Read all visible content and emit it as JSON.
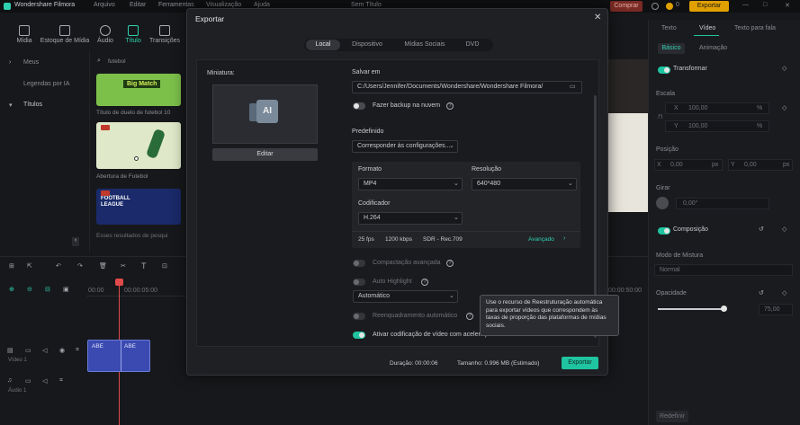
{
  "app": {
    "name": "Wondershare Filmora",
    "menu": [
      "Arquivo",
      "Editar",
      "Ferramentas",
      "Visualização",
      "Ajuda"
    ],
    "project_title": "Sem Título",
    "buy_label": "Comprar",
    "export_label": "Exportar",
    "coins": "0"
  },
  "toolbar_tabs": [
    "Mídia",
    "Estoque de Mídia",
    "Áudio",
    "Título",
    "Transições"
  ],
  "left_panel": {
    "categories": [
      "Meus",
      "Legendas por IA",
      "Títulos"
    ],
    "search_value": "futebol"
  },
  "media_items": [
    {
      "caption": "Título de duelo de futebol 10",
      "thumb_text": "Big Match"
    },
    {
      "caption": "Abertura de Futebol",
      "thumb_text": ""
    },
    {
      "caption": "",
      "thumb_text": "FOOTBALL LEAGUE"
    }
  ],
  "results_text": "Esses resultados de pesqui",
  "right_panel": {
    "tabs": [
      "Texto",
      "Vídeo",
      "Texto para fala"
    ],
    "subtabs": [
      "Básico",
      "Animação"
    ],
    "transform": "Transformar",
    "scale": "Escala",
    "scale_x": "100,00",
    "scale_y": "100,00",
    "percent": "%",
    "position": "Posição",
    "pos_x": "0,00",
    "pos_y": "0,00",
    "px": "px",
    "rotate": "Girar",
    "rotate_val": "0,00°",
    "composition": "Composição",
    "blend_mode": "Modo de Mistura",
    "blend_value": "Normal",
    "opacity": "Opacidade",
    "opacity_val": "75,00",
    "opacity_fraction": 0.75,
    "reset": "Redefinir",
    "x": "X",
    "y": "Y"
  },
  "timeline": {
    "times": [
      "00:00",
      "00:00:05:00",
      "00:00:50:00"
    ],
    "track_video": "Vídeo 1",
    "track_audio": "Áudio 1",
    "clip_label": "ABE"
  },
  "dialog": {
    "title": "Exportar",
    "tabs": [
      "Local",
      "Dispositivo",
      "Mídias Sociais",
      "DVD"
    ],
    "thumbnail_label": "Miniatura:",
    "edit_button": "Editar",
    "save_in_label": "Salvar em",
    "save_path": "C:/Users/Jennifer/Documents/Wondershare/Wondershare Filmora/",
    "cloud_backup": "Fazer backup na nuvem",
    "preset_label": "Predefinido",
    "preset_value": "Corresponder às configurações...",
    "format_label": "Formato",
    "format_value": "MP4",
    "resolution_label": "Resolução",
    "resolution_value": "640*480",
    "encoder_label": "Codificador",
    "encoder_value": "H.264",
    "fps": "25 fps",
    "bitrate": "1200 kbps",
    "color": "SDR - Rec.709",
    "advanced": "Avançado",
    "advanced_compression": "Compactação avançada",
    "auto_highlight": "Auto Highlight",
    "auto_value": "Automático",
    "auto_reframe": "Reenquadramento automático",
    "gpu_accel": "Ativar codificação de vídeo com aceleração de GPU",
    "duration": "Duração: 00:00:06",
    "size": "Tamanho: 0.996 MB (Estimado)",
    "export_button": "Exportar"
  },
  "tooltip": "Use o recurso de Reestruturação automática para exportar vídeos que correspondem às taxas de proporção das plataformas de mídias sociais.",
  "colors": {
    "accent": "#1fc4a0",
    "buy": "#c0392b",
    "export_top": "#e0a000"
  }
}
